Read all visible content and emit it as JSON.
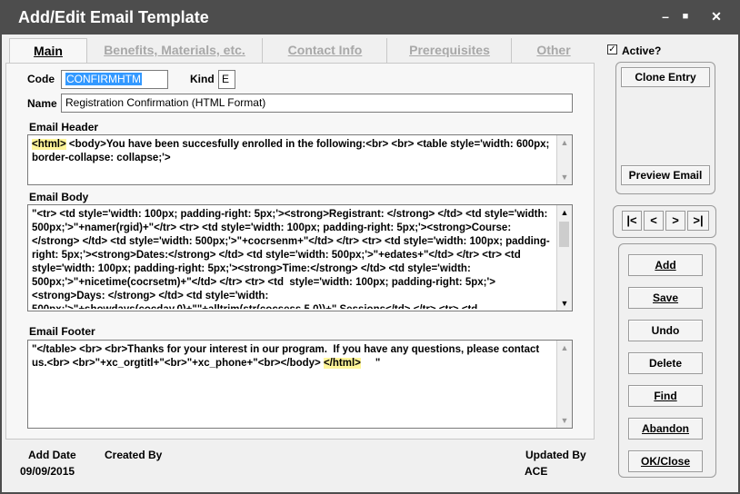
{
  "window": {
    "title": "Add/Edit Email Template",
    "minimize": "–",
    "maximize": "■",
    "close": "✕"
  },
  "tabs": [
    {
      "label": "Main"
    },
    {
      "label": "Benefits, Materials, etc."
    },
    {
      "label": "Contact Info"
    },
    {
      "label": "Prerequisites"
    },
    {
      "label": "Other"
    }
  ],
  "form": {
    "code_label": "Code",
    "code_value": "CONFIRMHTM",
    "kind_label": "Kind",
    "kind_value": "E",
    "name_label": "Name",
    "name_value": "Registration Confirmation (HTML Format)",
    "header_label": "Email Header",
    "header_open_tag": "<html>",
    "header_rest": " <body>You have been succesfully enrolled in the following:<br> <br> <table style='width: 600px; border-collapse: collapse;'>",
    "body_label": "Email Body",
    "body_text": "\"<tr> <td style='width: 100px; padding-right: 5px;'><strong>Registrant: </strong> </td> <td style='width: 500px;'>\"+namer(rgid)+\"</tr> <tr> <td style='width: 100px; padding-right: 5px;'><strong>Course: </strong> </td> <td style='width: 500px;'>\"+cocrsenm+\"</td> </tr> <tr> <td style='width: 100px; padding-right: 5px;'><strong>Dates:</strong> </td> <td style='width: 500px;'>\"+edates+\"</td> </tr> <tr> <td  style='width: 100px; padding-right: 5px;'><strong>Time:</strong> </td> <td style='width: 500px;'>\"+nicetime(cocrsetm)+\"</td> </tr> <tr> <td  style='width: 100px; padding-right: 5px;'><strong>Days: </strong> </td> <td style='width: 500px;'>\"+showdays(cocday,0)+\"\"+alltrim(str(cocsess,5,0))+\" Sessions</td> </tr> <tr> <td",
    "footer_label": "Email Footer",
    "footer_text": "\"</table> <br> <br>Thanks for your interest in our program.  If you have any questions, please contact us.<br> <br>\"+xc_orgtitl+\"<br>\"+xc_phone+\"<br></body> ",
    "footer_close_tag": "</html>",
    "footer_tail": "     \""
  },
  "footer_info": {
    "add_date_label": "Add Date",
    "add_date_value": "09/09/2015",
    "created_by_label": "Created By",
    "created_by_value": "",
    "updated_by_label": "Updated By",
    "updated_by_value": "ACE"
  },
  "side": {
    "active_label": "Active?",
    "active_checked": "✓",
    "clone_label": "Clone Entry",
    "preview_label": "Preview Email",
    "nav_first": "|<",
    "nav_prev": "<",
    "nav_next": ">",
    "nav_last": ">|",
    "add_label": "Add",
    "save_label": "Save",
    "undo_label": "Undo",
    "delete_label": "Delete",
    "find_label": "Find",
    "abandon_label": "Abandon",
    "ok_label": "OK/Close"
  },
  "colors": {
    "titlebar": "#4d4d4d",
    "code_highlight": "#3399ff",
    "tag_highlight": "#fff59a"
  }
}
